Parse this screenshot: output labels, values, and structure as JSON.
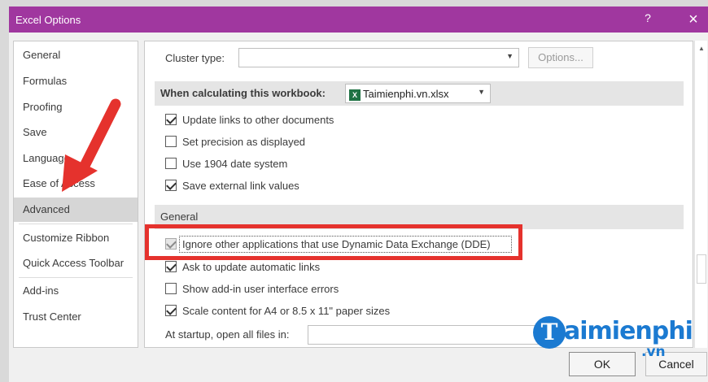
{
  "window": {
    "title": "Excel Options",
    "help_label": "?",
    "close_label": "×"
  },
  "sidebar": {
    "items": [
      {
        "label": "General"
      },
      {
        "label": "Formulas"
      },
      {
        "label": "Proofing"
      },
      {
        "label": "Save"
      },
      {
        "label": "Language"
      },
      {
        "label": "Ease of Access"
      },
      {
        "label": "Advanced"
      },
      {
        "label": "Customize Ribbon"
      },
      {
        "label": "Quick Access Toolbar"
      },
      {
        "label": "Add-ins"
      },
      {
        "label": "Trust Center"
      }
    ],
    "active": "Advanced"
  },
  "cluster": {
    "label": "Cluster type:",
    "value": "",
    "options_button": "Options..."
  },
  "workbook_section": {
    "label": "When calculating this workbook:",
    "file_value": "Taimienphi.vn.xlsx",
    "options": [
      {
        "label": "Update links to other documents",
        "checked": true
      },
      {
        "label": "Set precision as displayed",
        "checked": false
      },
      {
        "label": "Use 1904 date system",
        "checked": false
      },
      {
        "label": "Save external link values",
        "checked": true
      }
    ]
  },
  "general_section": {
    "label": "General",
    "options": [
      {
        "label": "Ignore other applications that use Dynamic Data Exchange (DDE)",
        "checked": true
      },
      {
        "label": "Ask to update automatic links",
        "checked": true
      },
      {
        "label": "Show add-in user interface errors",
        "checked": false
      },
      {
        "label": "Scale content for A4 or 8.5 x 11\" paper sizes",
        "checked": true
      }
    ],
    "startup_label": "At startup, open all files in:",
    "startup_value": ""
  },
  "footer": {
    "ok_label": "OK",
    "cancel_label": "Cancel"
  },
  "watermark": {
    "logo_letter": "T",
    "brand": "aimienphi",
    "domain": ".vn"
  },
  "colors": {
    "titlebar": "#a0379f",
    "highlight": "#e5322d",
    "arrow": "#e5322d",
    "watermark": "#1b7ad1",
    "excel_icon": "#1f7244"
  }
}
